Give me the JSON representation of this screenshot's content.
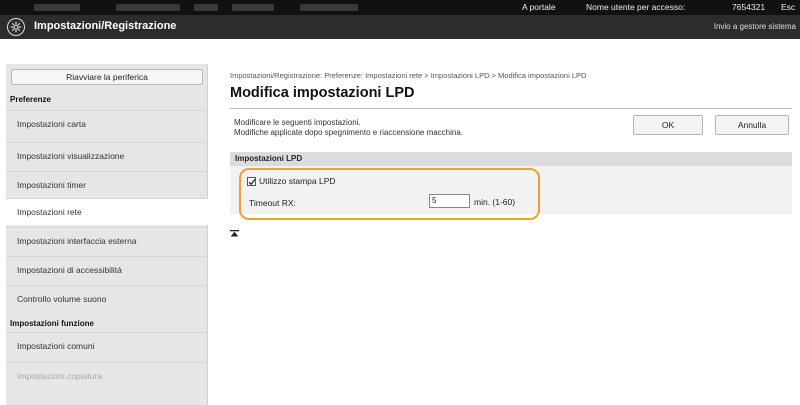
{
  "header": {
    "portal_link": "A portale",
    "user_label": "Nome utente per accesso:",
    "user_id": "7654321",
    "logout": "Esc"
  },
  "titlebar": {
    "title": "Impostazioni/Registrazione",
    "admin_mail": "Invio a gestore sistema"
  },
  "sidebar": {
    "restart_button": "Riavviare la periferica",
    "sections": [
      {
        "heading": "Preferenze",
        "items": [
          {
            "label": "Impostazioni carta"
          },
          {
            "label": "Impostazioni visualizzazione"
          },
          {
            "label": "Impostazioni timer"
          },
          {
            "label": "Impostazioni rete"
          },
          {
            "label": "Impostazioni interfaccia esterna"
          },
          {
            "label": "Impostazioni di accessibilità"
          },
          {
            "label": "Controllo volume suono"
          }
        ]
      },
      {
        "heading": "Impostazioni funzione",
        "items": [
          {
            "label": "Impostazioni comuni"
          },
          {
            "label": "Impostazioni copiatura"
          }
        ]
      }
    ]
  },
  "main": {
    "breadcrumb": "Impostazioni/Registrazione: Preferenze: Impostazioni rete > Impostazioni LPD > Modifica impostazioni LPD",
    "title": "Modifica impostazioni LPD",
    "desc_line1": "Modificare le seguenti impostazioni.",
    "desc_line2": "Modifiche applicate dopo spegnimento e riaccensione macchina.",
    "ok_button": "OK",
    "cancel_button": "Annulla",
    "section_title": "Impostazioni LPD",
    "lpd_checkbox_label": "Utilizzo stampa LPD",
    "lpd_checked": true,
    "timeout_label": "Timeout RX:",
    "timeout_value": "5",
    "timeout_unit": "min. (1-60)"
  },
  "colors": {
    "highlight": "#f0a030",
    "title_bar": "#2c2c2c"
  }
}
